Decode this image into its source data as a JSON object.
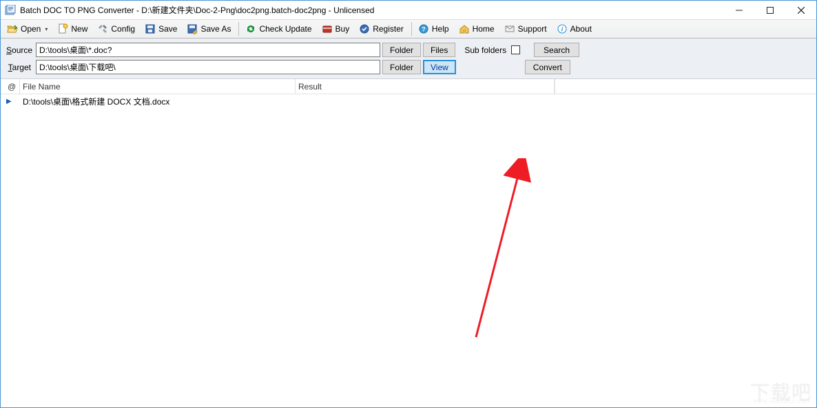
{
  "window": {
    "title": "Batch DOC TO PNG Converter - D:\\新建文件夹\\Doc-2-Png\\doc2png.batch-doc2png - Unlicensed"
  },
  "toolbar": {
    "open": "Open",
    "new": "New",
    "config": "Config",
    "save": "Save",
    "save_as": "Save As",
    "check_update": "Check Update",
    "buy": "Buy",
    "register": "Register",
    "help": "Help",
    "home": "Home",
    "support": "Support",
    "about": "About"
  },
  "path": {
    "source_label": "Source",
    "source_value": "D:\\tools\\桌面\\*.doc?",
    "target_label": "Target",
    "target_value": "D:\\tools\\桌面\\下载吧\\",
    "folder_btn": "Folder",
    "files_btn": "Files",
    "sub_folders_label": "Sub folders",
    "search_btn": "Search",
    "view_btn": "View",
    "convert_btn": "Convert"
  },
  "list": {
    "col_at": "@",
    "col_filename": "File Name",
    "col_result": "Result",
    "rows": [
      {
        "filename": "D:\\tools\\桌面\\格式新建 DOCX 文档.docx",
        "result": ""
      }
    ]
  },
  "watermark": {
    "text": "下载吧",
    "url": "www.xiazaiba.com"
  }
}
